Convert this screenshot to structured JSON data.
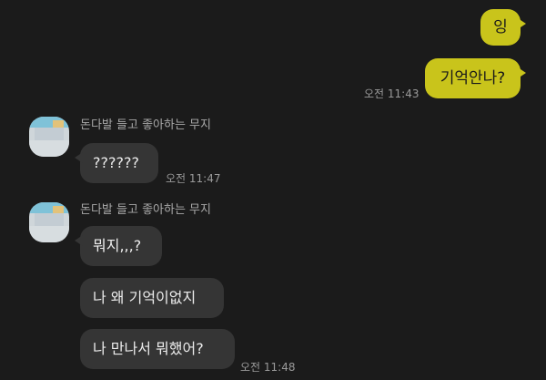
{
  "chat": {
    "messages_out": [
      {
        "text": "잉"
      },
      {
        "text": "기억안나?",
        "time": "오전 11:43"
      }
    ],
    "group1": {
      "sender": "돈다발 들고 좋아하는 무지",
      "avatar_icon": "muji-avatar-icon",
      "messages": [
        {
          "text": "??????",
          "time": "오전 11:47"
        }
      ]
    },
    "group2": {
      "sender": "돈다발 들고 좋아하는 무지",
      "avatar_icon": "muji-avatar-icon",
      "messages": [
        {
          "text": "뭐지,,,?"
        },
        {
          "text": "나 왜 기억이없지"
        },
        {
          "text": "나 만나서 뭐했어?",
          "time": "오전 11:48"
        }
      ]
    }
  },
  "colors": {
    "background": "#1b1b1b",
    "outgoing_bubble": "#c9c41b",
    "incoming_bubble": "#353535",
    "timestamp": "#9a9a9a"
  }
}
